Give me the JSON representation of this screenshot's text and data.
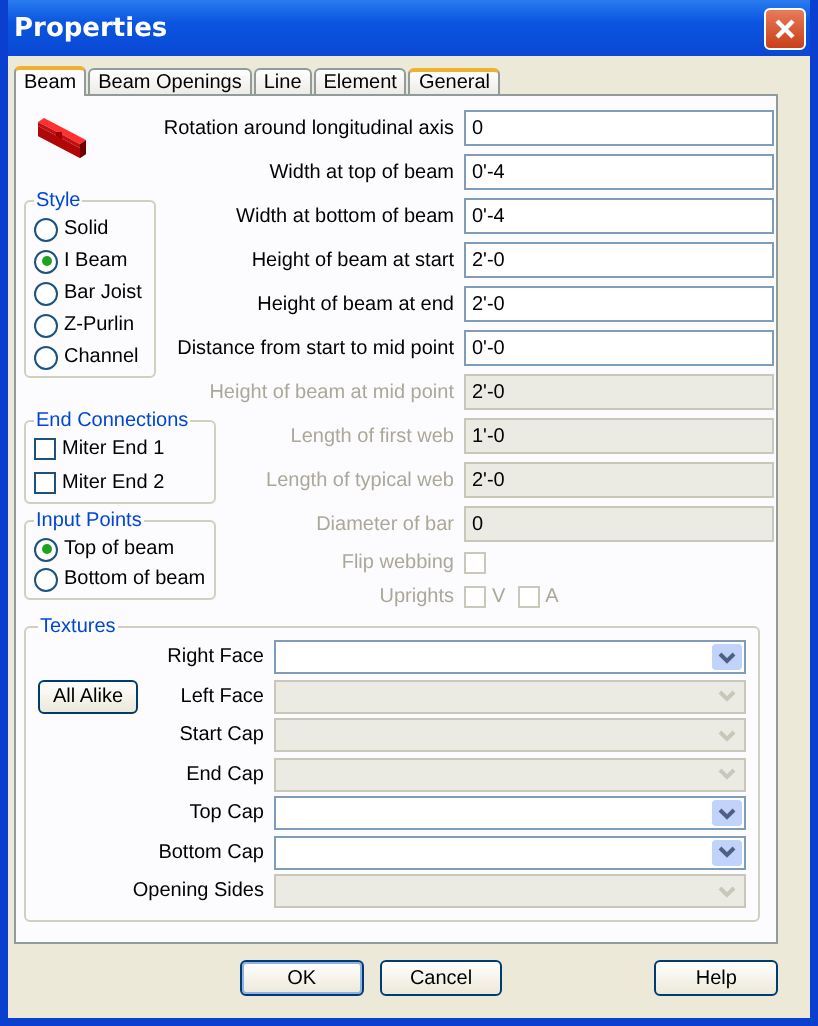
{
  "window": {
    "title": "Properties"
  },
  "tabs": [
    {
      "label": "Beam",
      "selected": true,
      "highlighted": true
    },
    {
      "label": "Beam Openings",
      "selected": false,
      "highlighted": false
    },
    {
      "label": "Line",
      "selected": false,
      "highlighted": false
    },
    {
      "label": "Element",
      "selected": false,
      "highlighted": false
    },
    {
      "label": "General",
      "selected": false,
      "highlighted": true
    }
  ],
  "fields": [
    {
      "kind": "text",
      "label": "Rotation around longitudinal axis",
      "value": "0",
      "disabled": false
    },
    {
      "kind": "text",
      "label": "Width at top of beam",
      "value": "0'-4",
      "disabled": false
    },
    {
      "kind": "text",
      "label": "Width at bottom of beam",
      "value": "0'-4",
      "disabled": false
    },
    {
      "kind": "text",
      "label": "Height of beam at start",
      "value": "2'-0",
      "disabled": false
    },
    {
      "kind": "text",
      "label": "Height of beam at end",
      "value": "2'-0",
      "disabled": false
    },
    {
      "kind": "text",
      "label": "Distance from start to mid point",
      "value": "0'-0",
      "disabled": false
    },
    {
      "kind": "text",
      "label": "Height of beam at mid point",
      "value": "2'-0",
      "disabled": true
    },
    {
      "kind": "text",
      "label": "Length of first web",
      "value": "1'-0",
      "disabled": true
    },
    {
      "kind": "text",
      "label": "Length of typical web",
      "value": "2'-0",
      "disabled": true
    },
    {
      "kind": "text",
      "label": "Diameter of bar",
      "value": "0",
      "disabled": true
    },
    {
      "kind": "checkbox",
      "label": "Flip webbing",
      "checked": false,
      "disabled": true
    },
    {
      "kind": "checkboxes",
      "label": "Uprights",
      "disabled": true,
      "options": [
        {
          "label": "V",
          "checked": false
        },
        {
          "label": "A",
          "checked": false
        }
      ]
    }
  ],
  "style": {
    "title": "Style",
    "options": [
      {
        "label": "Solid",
        "selected": false
      },
      {
        "label": "I Beam",
        "selected": true
      },
      {
        "label": "Bar Joist",
        "selected": false
      },
      {
        "label": "Z-Purlin",
        "selected": false
      },
      {
        "label": "Channel",
        "selected": false
      }
    ]
  },
  "end_connections": {
    "title": "End Connections",
    "items": [
      {
        "label": "Miter End 1",
        "checked": false
      },
      {
        "label": "Miter End 2",
        "checked": false
      }
    ]
  },
  "input_points": {
    "title": "Input Points",
    "options": [
      {
        "label": "Top of beam",
        "selected": true
      },
      {
        "label": "Bottom of beam",
        "selected": false
      }
    ]
  },
  "textures": {
    "title": "Textures",
    "button": "All Alike",
    "combos": [
      {
        "label": "Right Face",
        "disabled": false
      },
      {
        "label": "Left Face",
        "disabled": true
      },
      {
        "label": "Start Cap",
        "disabled": true
      },
      {
        "label": "End Cap",
        "disabled": true
      },
      {
        "label": "Top Cap",
        "disabled": false
      },
      {
        "label": "Bottom Cap",
        "disabled": false
      },
      {
        "label": "Opening Sides",
        "disabled": true
      }
    ]
  },
  "buttons": [
    {
      "label": "OK",
      "default": true
    },
    {
      "label": "Cancel",
      "default": false
    },
    {
      "label": "Help",
      "default": false
    }
  ]
}
